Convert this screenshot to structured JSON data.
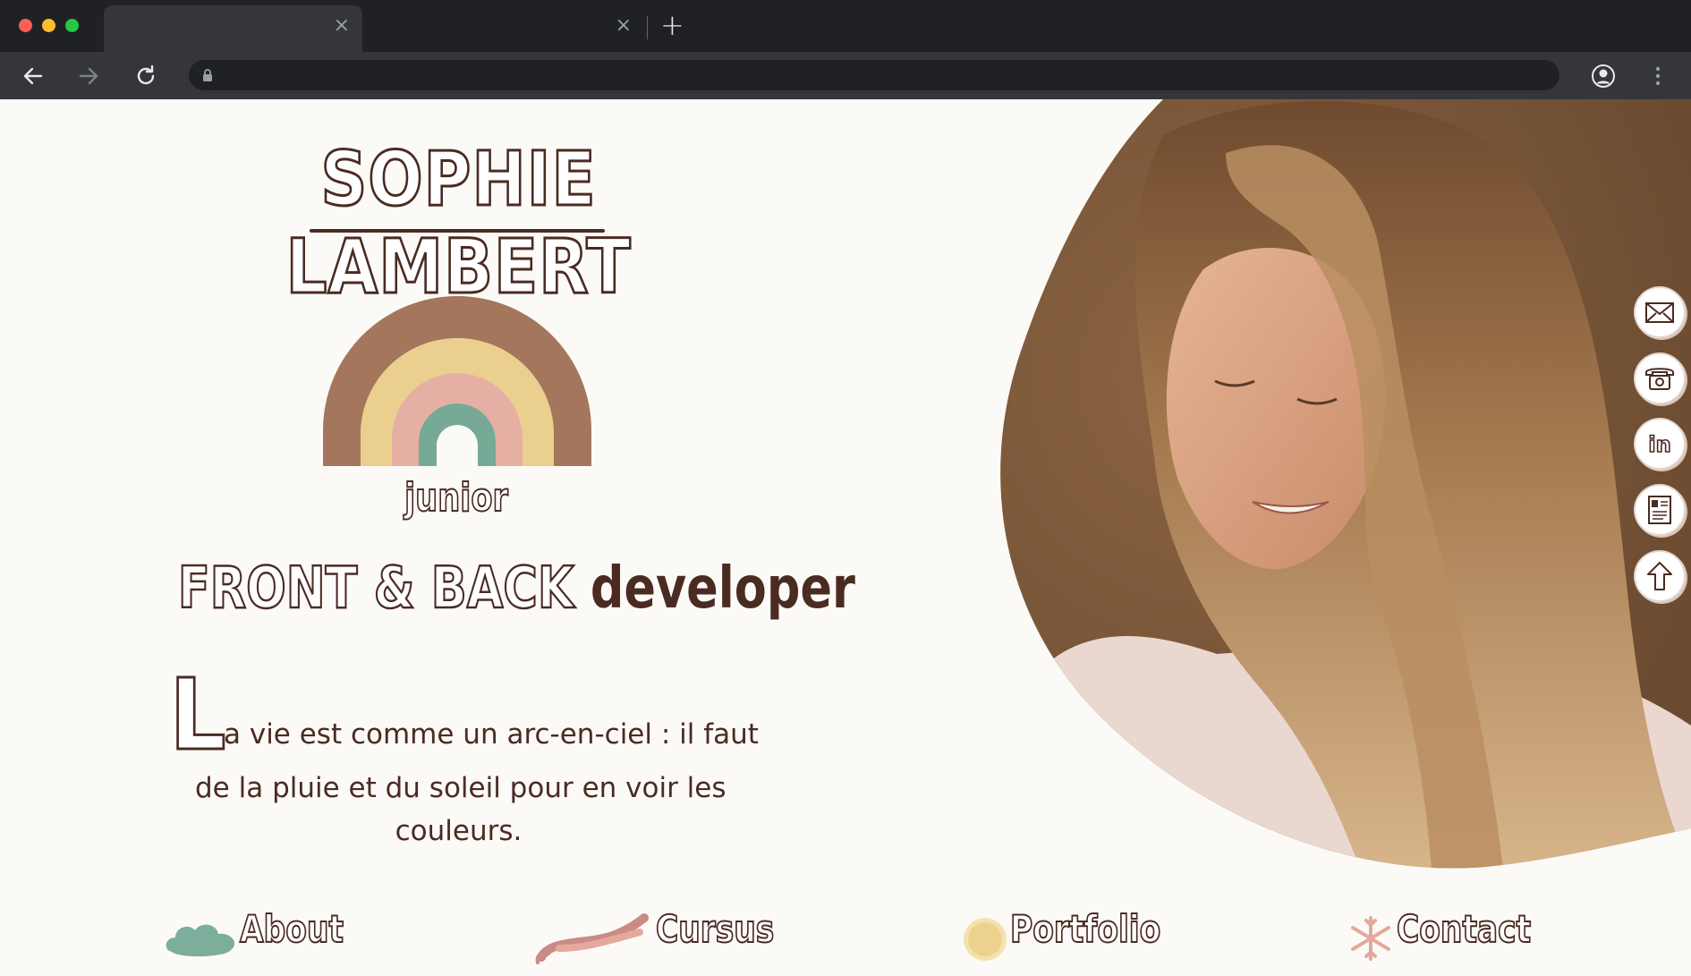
{
  "browser": {
    "tabs": [
      {
        "label": "",
        "active": true
      },
      {
        "label": "",
        "active": false
      }
    ],
    "new_tab_icon": "plus-icon",
    "address": ""
  },
  "header": {
    "name": "SOPHIE LAMBERT",
    "level": "junior",
    "role_part1": "FRONT & BACK",
    "role_part2": "developer"
  },
  "quote": {
    "dropcap": "L",
    "line1": "a vie est comme un arc-en-ciel : il faut",
    "line2": "de la pluie et du soleil pour en voir les",
    "line3": "couleurs."
  },
  "social_links": [
    {
      "icon": "envelope-icon"
    },
    {
      "icon": "telephone-icon"
    },
    {
      "icon": "linkedin-icon"
    },
    {
      "icon": "cv-document-icon"
    },
    {
      "icon": "arrow-up-icon"
    }
  ],
  "nav": {
    "about": "About",
    "cursus": "Cursus",
    "portfolio": "Portfolio",
    "contact": "Contact"
  },
  "colors": {
    "text_brown": "#4a2b22",
    "background": "#fcfaf7",
    "rainbow": [
      "#9c6b4e",
      "#e8cb85",
      "#e4a89c",
      "#6fa590"
    ]
  }
}
